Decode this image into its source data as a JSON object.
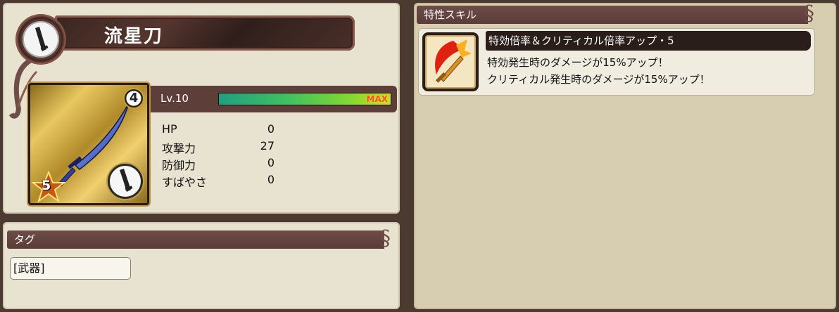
{
  "weapon": {
    "name": "流星刀",
    "rank": "4",
    "stars": "5",
    "level_label": "Lv.10",
    "exp_max_label": "MAX",
    "exp_progress": 1.0
  },
  "stats": [
    {
      "name": "HP",
      "value": "0"
    },
    {
      "name": "攻撃力",
      "value": "27"
    },
    {
      "name": "防御力",
      "value": "0"
    },
    {
      "name": "すばやさ",
      "value": "0"
    }
  ],
  "tags": {
    "header": "タグ",
    "items": [
      "[武器]"
    ]
  },
  "skills": {
    "header": "特性スキル",
    "items": [
      {
        "title": "特効倍率＆クリティカル倍率アップ・5",
        "lines": [
          "特効発生時のダメージが15%アップ！",
          "クリティカル発生時のダメージが15%アップ！"
        ]
      }
    ]
  },
  "icons": {
    "weapon_type": "sword-icon",
    "skill": "flaming-sword-icon"
  },
  "colors": {
    "ribbon": "#6e4c47",
    "panel": "#e8e2d0",
    "exp_fill_start": "#20a080",
    "exp_fill_end": "#c8e020",
    "max_text": "#ff5020"
  }
}
